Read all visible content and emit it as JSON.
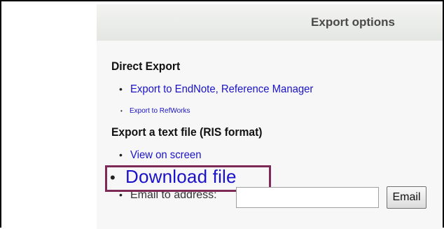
{
  "panel": {
    "title": "Export options"
  },
  "direct_export": {
    "heading": "Direct Export",
    "links": [
      {
        "label": "Export to EndNote, Reference Manager"
      },
      {
        "label": "Export to RefWorks"
      }
    ]
  },
  "text_export": {
    "heading": "Export a text file (RIS format)",
    "view_label": "View on screen",
    "download_label": "Download file",
    "email_label": "Email to address:",
    "email_value": "",
    "email_button": "Email"
  },
  "bullet": "•",
  "colors": {
    "link": "#1a12c8",
    "highlight_border": "#7d2a57",
    "header_bg": "#e4e6e2"
  }
}
